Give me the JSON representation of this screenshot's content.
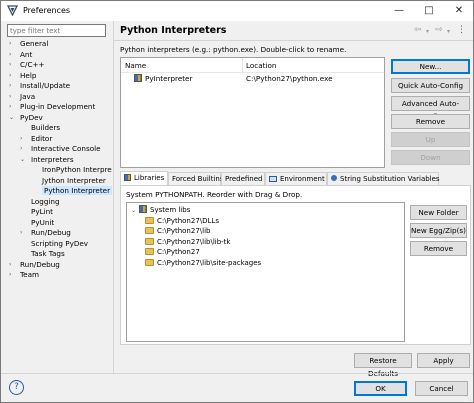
{
  "window": {
    "title": "Preferences",
    "colors": {
      "accent": "#0078d7",
      "selection": "#cce8ff"
    }
  },
  "titlebar_icons": [
    "minimize-icon",
    "maximize-icon",
    "close-icon"
  ],
  "filter": {
    "placeholder": "type filter text",
    "value": ""
  },
  "tree": [
    {
      "label": "General",
      "state": "collapsed"
    },
    {
      "label": "Ant",
      "state": "collapsed"
    },
    {
      "label": "C/C++",
      "state": "collapsed"
    },
    {
      "label": "Help",
      "state": "collapsed"
    },
    {
      "label": "Install/Update",
      "state": "collapsed"
    },
    {
      "label": "Java",
      "state": "collapsed"
    },
    {
      "label": "Plug-in Development",
      "state": "collapsed"
    },
    {
      "label": "PyDev",
      "state": "expanded"
    },
    {
      "label": "Builders",
      "state": "leaf"
    },
    {
      "label": "Editor",
      "state": "collapsed"
    },
    {
      "label": "Interactive Console",
      "state": "collapsed"
    },
    {
      "label": "Interpreters",
      "state": "expanded"
    },
    {
      "label": "IronPython Interpre",
      "state": "leaf"
    },
    {
      "label": "Jython Interpreter",
      "state": "leaf"
    },
    {
      "label": "Python Interpreter",
      "state": "leaf",
      "selected": true
    },
    {
      "label": "Logging",
      "state": "leaf"
    },
    {
      "label": "PyLint",
      "state": "leaf"
    },
    {
      "label": "PyUnit",
      "state": "leaf"
    },
    {
      "label": "Run/Debug",
      "state": "collapsed"
    },
    {
      "label": "Scripting PyDev",
      "state": "leaf"
    },
    {
      "label": "Task Tags",
      "state": "leaf"
    },
    {
      "label": "Run/Debug",
      "state": "collapsed"
    },
    {
      "label": "Team",
      "state": "collapsed"
    }
  ],
  "page": {
    "title": "Python Interpreters",
    "description": "Python interpreters (e.g.: python.exe).   Double-click to rename.",
    "table": {
      "columns": [
        "Name",
        "Location"
      ],
      "rows": [
        {
          "name": "PyInterpreter",
          "location": "C:\\Python27\\python.exe"
        }
      ]
    },
    "buttons": {
      "new": "New...",
      "quick": "Quick Auto-Config",
      "advanced": "Advanced Auto-Config",
      "remove": "Remove",
      "up": "Up",
      "down": "Down"
    },
    "tabs": [
      "Libraries",
      "Forced Builtins",
      "Predefined",
      "Environment",
      "String Substitution Variables"
    ],
    "libraries": {
      "description": "System PYTHONPATH.   Reorder with Drag & Drop.",
      "root": "System libs",
      "paths": [
        "C:\\Python27\\DLLs",
        "C:\\Python27\\lib",
        "C:\\Python27\\lib\\lib-tk",
        "C:\\Python27",
        "C:\\Python27\\lib\\site-packages"
      ],
      "buttons": {
        "new_folder": "New Folder",
        "new_egg": "New Egg/Zip(s)",
        "remove": "Remove"
      }
    },
    "restore": "Restore Defaults",
    "apply": "Apply"
  },
  "footer": {
    "ok": "OK",
    "cancel": "Cancel"
  }
}
